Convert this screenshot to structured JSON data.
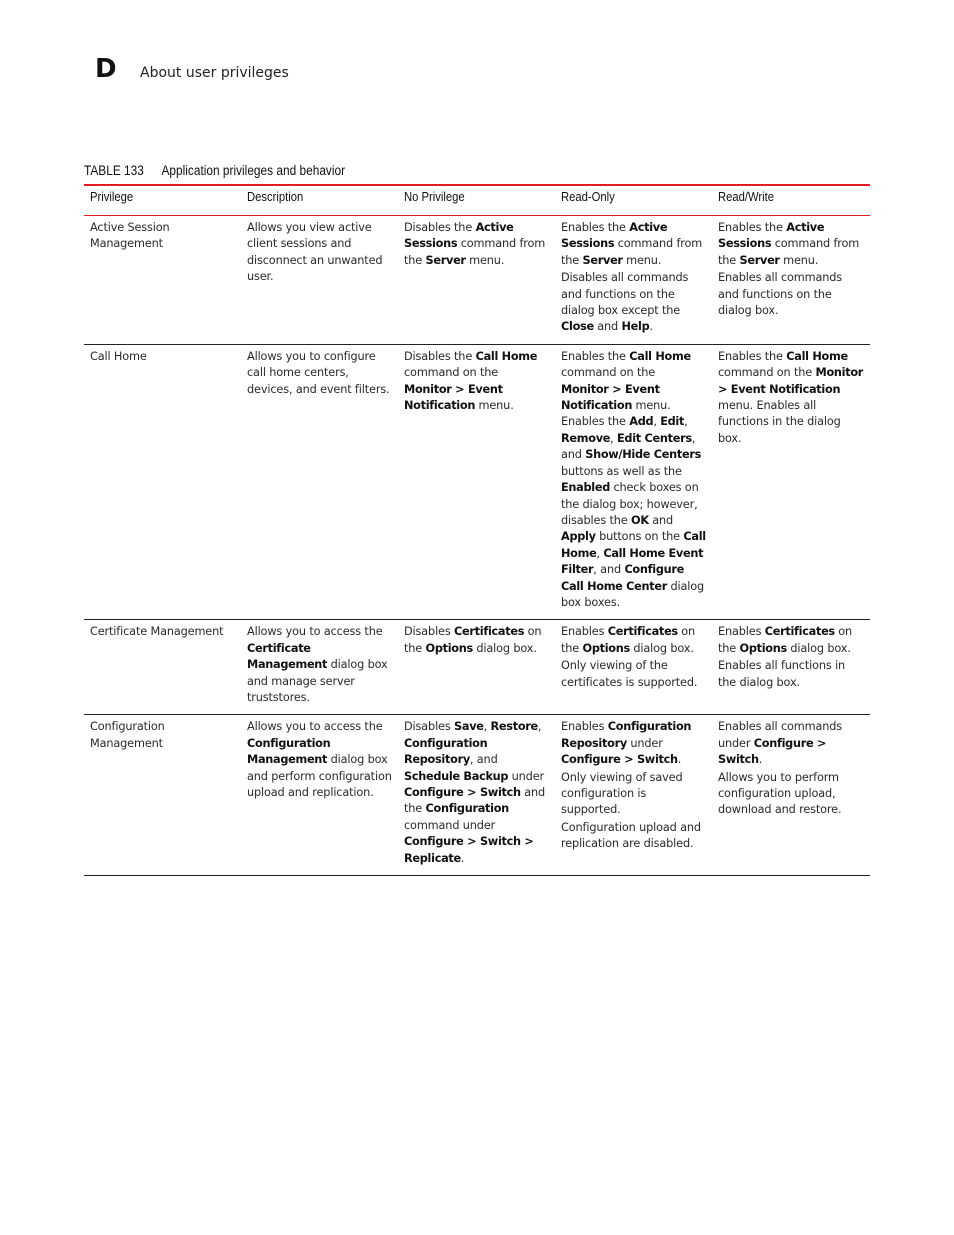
{
  "page_header": {
    "appendix_letter": "D",
    "section_title": "About user privileges"
  },
  "table": {
    "number": "TABLE 133",
    "caption": "Application privileges and behavior",
    "accent_color": "#e31b23",
    "columns": [
      "Privilege",
      "Description",
      "No Privilege",
      "Read-Only",
      "Read/Write"
    ],
    "rows": [
      {
        "privilege": "Active Session Management",
        "cells": [
          [
            [
              {
                "t": "Active Session Management",
                "b": false
              }
            ]
          ],
          [
            [
              {
                "t": "Allows you view active client sessions and disconnect an unwanted user.",
                "b": false
              }
            ]
          ],
          [
            [
              {
                "t": "Disables the ",
                "b": false
              },
              {
                "t": "Active Sessions",
                "b": true
              },
              {
                "t": " command from the ",
                "b": false
              },
              {
                "t": "Server",
                "b": true
              },
              {
                "t": " menu.",
                "b": false
              }
            ]
          ],
          [
            [
              {
                "t": "Enables the ",
                "b": false
              },
              {
                "t": "Active Sessions",
                "b": true
              },
              {
                "t": " command from the ",
                "b": false
              },
              {
                "t": "Server",
                "b": true
              },
              {
                "t": " menu.",
                "b": false
              }
            ],
            [
              {
                "t": "Disables all commands and functions on the dialog box except the ",
                "b": false
              },
              {
                "t": "Close",
                "b": true
              },
              {
                "t": " and ",
                "b": false
              },
              {
                "t": "Help",
                "b": true
              },
              {
                "t": ".",
                "b": false
              }
            ]
          ],
          [
            [
              {
                "t": "Enables the ",
                "b": false
              },
              {
                "t": "Active Sessions",
                "b": true
              },
              {
                "t": " command from the ",
                "b": false
              },
              {
                "t": "Server",
                "b": true
              },
              {
                "t": " menu.",
                "b": false
              }
            ],
            [
              {
                "t": "Enables all commands and functions on the dialog box.",
                "b": false
              }
            ]
          ]
        ]
      },
      {
        "privilege": "Call Home",
        "cells": [
          [
            [
              {
                "t": "Call Home",
                "b": false
              }
            ]
          ],
          [
            [
              {
                "t": "Allows you to configure call home centers, devices, and event filters.",
                "b": false
              }
            ]
          ],
          [
            [
              {
                "t": "Disables the ",
                "b": false
              },
              {
                "t": "Call Home",
                "b": true
              },
              {
                "t": " command on the ",
                "b": false
              },
              {
                "t": "Monitor > Event Notification",
                "b": true
              },
              {
                "t": " menu.",
                "b": false
              }
            ]
          ],
          [
            [
              {
                "t": "Enables the ",
                "b": false
              },
              {
                "t": "Call Home",
                "b": true
              },
              {
                "t": " command on the ",
                "b": false
              },
              {
                "t": "Monitor > Event Notification",
                "b": true
              },
              {
                "t": " menu. Enables the ",
                "b": false
              },
              {
                "t": "Add",
                "b": true
              },
              {
                "t": ", ",
                "b": false
              },
              {
                "t": "Edit",
                "b": true
              },
              {
                "t": ", ",
                "b": false
              },
              {
                "t": "Remove",
                "b": true
              },
              {
                "t": ", ",
                "b": false
              },
              {
                "t": "Edit Centers",
                "b": true
              },
              {
                "t": ", and ",
                "b": false
              },
              {
                "t": "Show/Hide Centers",
                "b": true
              },
              {
                "t": " buttons as well as the ",
                "b": false
              },
              {
                "t": "Enabled",
                "b": true
              },
              {
                "t": " check boxes on the dialog box; however, disables the ",
                "b": false
              },
              {
                "t": "OK",
                "b": true
              },
              {
                "t": " and ",
                "b": false
              },
              {
                "t": "Apply",
                "b": true
              },
              {
                "t": " buttons on the ",
                "b": false
              },
              {
                "t": "Call Home",
                "b": true
              },
              {
                "t": ", ",
                "b": false
              },
              {
                "t": "Call Home Event Filter",
                "b": true
              },
              {
                "t": ", and ",
                "b": false
              },
              {
                "t": "Configure Call Home Center",
                "b": true
              },
              {
                "t": " dialog box boxes.",
                "b": false
              }
            ]
          ],
          [
            [
              {
                "t": "Enables the ",
                "b": false
              },
              {
                "t": "Call Home",
                "b": true
              },
              {
                "t": " command on the ",
                "b": false
              },
              {
                "t": "Monitor > Event Notification",
                "b": true
              },
              {
                "t": " menu. Enables all functions in the dialog box.",
                "b": false
              }
            ]
          ]
        ]
      },
      {
        "privilege": "Certificate Management",
        "cells": [
          [
            [
              {
                "t": "Certificate Management",
                "b": false
              }
            ]
          ],
          [
            [
              {
                "t": "Allows you to access the ",
                "b": false
              },
              {
                "t": "Certificate Management",
                "b": true
              },
              {
                "t": " dialog box and manage server truststores.",
                "b": false
              }
            ]
          ],
          [
            [
              {
                "t": "Disables ",
                "b": false
              },
              {
                "t": "Certificates",
                "b": true
              },
              {
                "t": " on the ",
                "b": false
              },
              {
                "t": "Options",
                "b": true
              },
              {
                "t": " dialog box.",
                "b": false
              }
            ]
          ],
          [
            [
              {
                "t": "Enables ",
                "b": false
              },
              {
                "t": "Certificates",
                "b": true
              },
              {
                "t": " on the ",
                "b": false
              },
              {
                "t": "Options",
                "b": true
              },
              {
                "t": " dialog box.",
                "b": false
              }
            ],
            [
              {
                "t": "Only viewing of the certificates is supported.",
                "b": false
              }
            ]
          ],
          [
            [
              {
                "t": "Enables ",
                "b": false
              },
              {
                "t": "Certificates",
                "b": true
              },
              {
                "t": " on the ",
                "b": false
              },
              {
                "t": "Options",
                "b": true
              },
              {
                "t": " dialog box.",
                "b": false
              }
            ],
            [
              {
                "t": "Enables all functions in the dialog box.",
                "b": false
              }
            ]
          ]
        ]
      },
      {
        "privilege": "Configuration Management",
        "cells": [
          [
            [
              {
                "t": "Configuration Management",
                "b": false
              }
            ]
          ],
          [
            [
              {
                "t": "Allows you to access the ",
                "b": false
              },
              {
                "t": "Configuration Management",
                "b": true
              },
              {
                "t": " dialog box and perform configuration upload and replication.",
                "b": false
              }
            ]
          ],
          [
            [
              {
                "t": "Disables ",
                "b": false
              },
              {
                "t": "Save",
                "b": true
              },
              {
                "t": ", ",
                "b": false
              },
              {
                "t": "Restore",
                "b": true
              },
              {
                "t": ", ",
                "b": false
              },
              {
                "t": "Configuration Repository",
                "b": true
              },
              {
                "t": ", and ",
                "b": false
              },
              {
                "t": "Schedule Backup",
                "b": true
              },
              {
                "t": " under ",
                "b": false
              },
              {
                "t": "Configure > Switch",
                "b": true
              },
              {
                "t": " and the ",
                "b": false
              },
              {
                "t": "Configuration",
                "b": true
              },
              {
                "t": " command under ",
                "b": false
              },
              {
                "t": "Configure > Switch > Replicate",
                "b": true
              },
              {
                "t": ".",
                "b": false
              }
            ]
          ],
          [
            [
              {
                "t": "Enables ",
                "b": false
              },
              {
                "t": "Configuration Repository",
                "b": true
              },
              {
                "t": " under ",
                "b": false
              },
              {
                "t": "Configure > Switch",
                "b": true
              },
              {
                "t": ".",
                "b": false
              }
            ],
            [
              {
                "t": "Only viewing of saved configuration is supported.",
                "b": false
              }
            ],
            [
              {
                "t": "Configuration upload and replication are disabled.",
                "b": false
              }
            ]
          ],
          [
            [
              {
                "t": "Enables all commands under ",
                "b": false
              },
              {
                "t": "Configure > Switch",
                "b": true
              },
              {
                "t": ".",
                "b": false
              }
            ],
            [
              {
                "t": "Allows you to perform configuration upload, download and restore.",
                "b": false
              }
            ]
          ]
        ]
      }
    ]
  }
}
